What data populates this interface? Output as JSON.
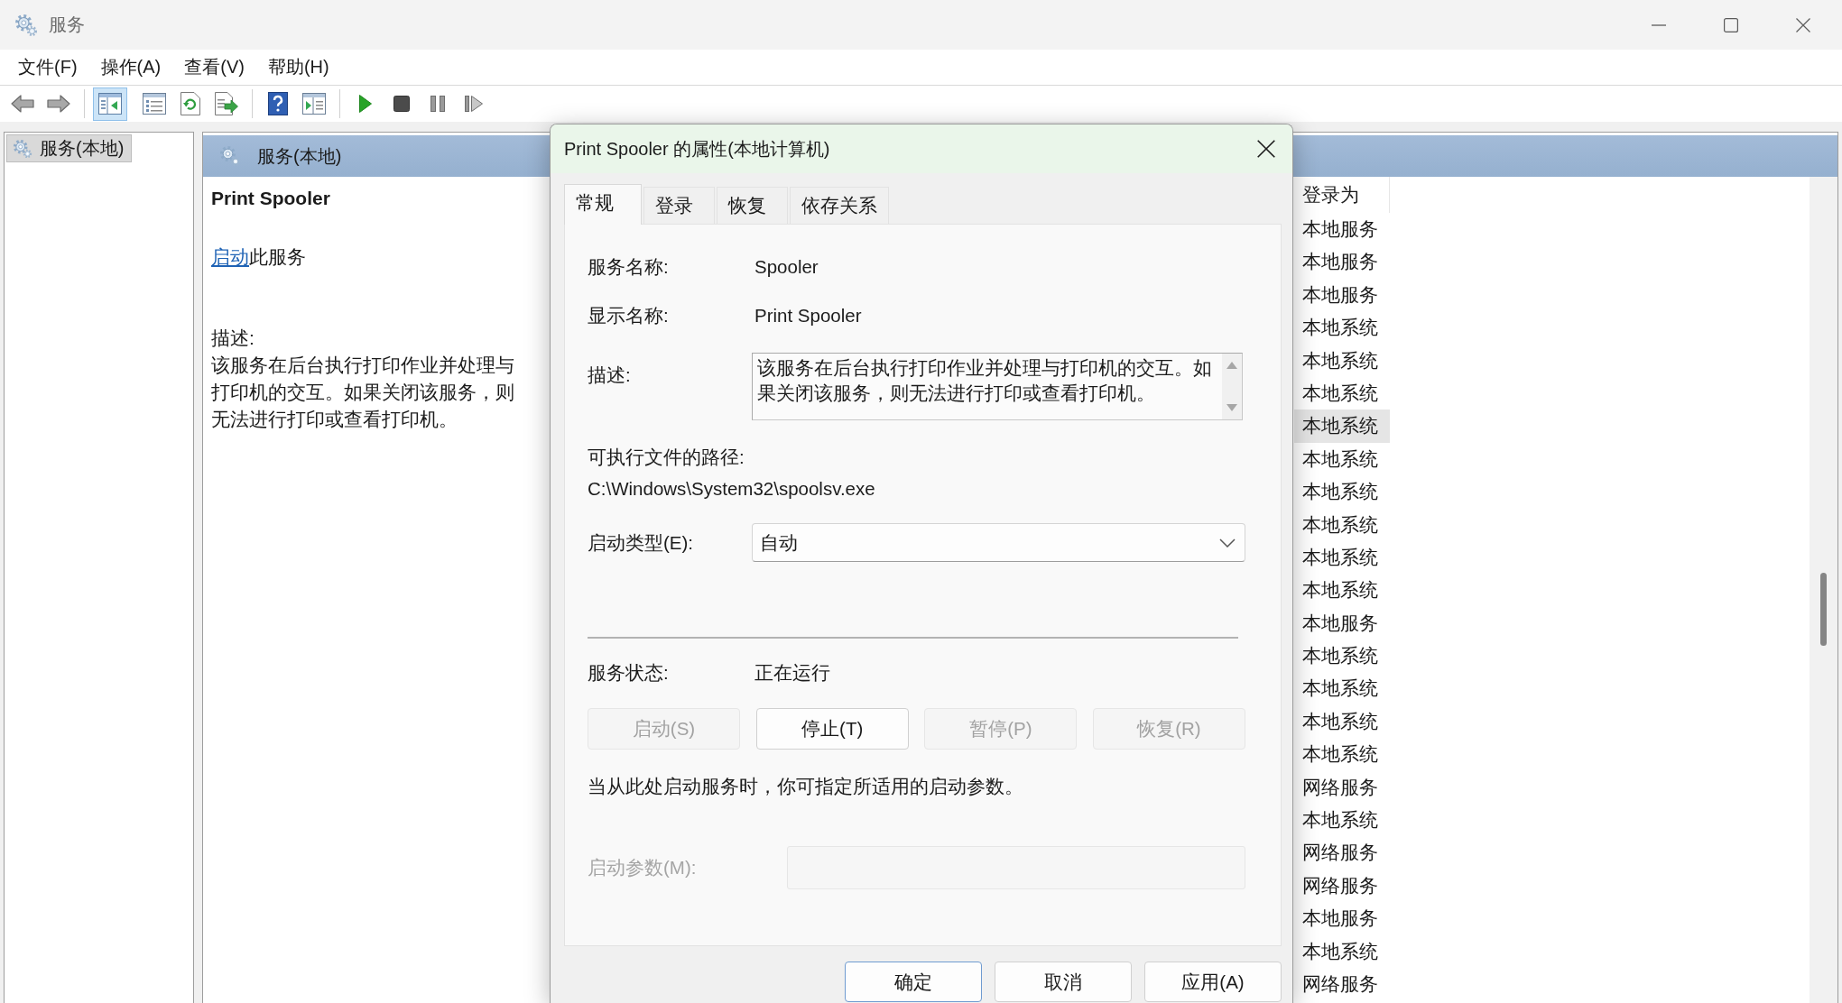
{
  "window": {
    "title": "服务"
  },
  "menu": [
    "文件(F)",
    "操作(A)",
    "查看(V)",
    "帮助(H)"
  ],
  "toolbar_groups": [
    [
      {
        "kind": "back",
        "pressed": false
      },
      {
        "kind": "forward",
        "pressed": false
      }
    ],
    [
      {
        "kind": "console-tree",
        "pressed": true
      },
      {
        "kind": "properties",
        "pressed": false
      },
      {
        "kind": "refresh",
        "pressed": false
      },
      {
        "kind": "export",
        "pressed": false
      }
    ],
    [
      {
        "kind": "help",
        "pressed": false
      },
      {
        "kind": "action-pane",
        "pressed": false
      }
    ],
    [
      {
        "kind": "start",
        "pressed": false
      },
      {
        "kind": "stop",
        "pressed": false
      },
      {
        "kind": "pause",
        "pressed": false
      },
      {
        "kind": "resume",
        "pressed": false
      }
    ]
  ],
  "tree": [
    {
      "label": "服务(本地)",
      "selected": true
    }
  ],
  "pane": {
    "title": "服务(本地)"
  },
  "details": {
    "service_name": "Print Spooler",
    "action": {
      "link": "启动",
      "text": "此服务"
    },
    "description_label": "描述:",
    "description": "该服务在后台执行打印作业并处理与打印机的交互。如果关闭该服务，则无法进行打印或查看打印机。"
  },
  "list": {
    "columns": [
      "登录为"
    ],
    "rows": [
      {
        "log_on_as": "本地服务",
        "selected": false
      },
      {
        "log_on_as": "本地服务",
        "selected": false
      },
      {
        "log_on_as": "本地服务",
        "selected": false
      },
      {
        "log_on_as": "本地系统",
        "selected": false
      },
      {
        "log_on_as": "本地系统",
        "selected": false
      },
      {
        "log_on_as": "本地系统",
        "selected": false
      },
      {
        "log_on_as": "本地系统",
        "selected": true
      },
      {
        "log_on_as": "本地系统",
        "selected": false
      },
      {
        "log_on_as": "本地系统",
        "selected": false
      },
      {
        "log_on_as": "本地系统",
        "selected": false
      },
      {
        "log_on_as": "本地系统",
        "selected": false
      },
      {
        "log_on_as": "本地系统",
        "selected": false
      },
      {
        "log_on_as": "本地服务",
        "selected": false
      },
      {
        "log_on_as": "本地系统",
        "selected": false
      },
      {
        "log_on_as": "本地系统",
        "selected": false
      },
      {
        "log_on_as": "本地系统",
        "selected": false
      },
      {
        "log_on_as": "本地系统",
        "selected": false
      },
      {
        "log_on_as": "网络服务",
        "selected": false
      },
      {
        "log_on_as": "本地系统",
        "selected": false
      },
      {
        "log_on_as": "网络服务",
        "selected": false
      },
      {
        "log_on_as": "网络服务",
        "selected": false
      },
      {
        "log_on_as": "本地服务",
        "selected": false
      },
      {
        "log_on_as": "本地系统",
        "selected": false
      },
      {
        "log_on_as": "网络服务",
        "selected": false
      }
    ]
  },
  "dialog": {
    "title": "Print Spooler 的属性(本地计算机)",
    "tabs": [
      {
        "label": "常规",
        "selected": true
      },
      {
        "label": "登录",
        "selected": false
      },
      {
        "label": "恢复",
        "selected": false
      },
      {
        "label": "依存关系",
        "selected": false
      }
    ],
    "service_name": {
      "label": "服务名称:",
      "value": "Spooler"
    },
    "display_name": {
      "label": "显示名称:",
      "value": "Print Spooler"
    },
    "description": {
      "label": "描述:",
      "value": "该服务在后台执行打印作业并处理与打印机的交互。如果关闭该服务，则无法进行打印或查看打印机。"
    },
    "executable_path": {
      "label": "可执行文件的路径:",
      "value": "C:\\Windows\\System32\\spoolsv.exe"
    },
    "startup_type": {
      "label": "启动类型(E):",
      "value": "自动"
    },
    "service_status": {
      "label": "服务状态:",
      "value": "正在运行"
    },
    "control_buttons": [
      {
        "label": "启动(S)",
        "disabled": true
      },
      {
        "label": "停止(T)",
        "disabled": false
      },
      {
        "label": "暂停(P)",
        "disabled": true
      },
      {
        "label": "恢复(R)",
        "disabled": true
      }
    ],
    "hint": "当从此处启动服务时，你可指定所适用的启动参数。",
    "start_parameters": {
      "label": "启动参数(M):",
      "disabled": true
    },
    "buttons": [
      {
        "label": "确定",
        "default": true
      },
      {
        "label": "取消",
        "default": false
      },
      {
        "label": "应用(A)",
        "default": false
      }
    ]
  }
}
